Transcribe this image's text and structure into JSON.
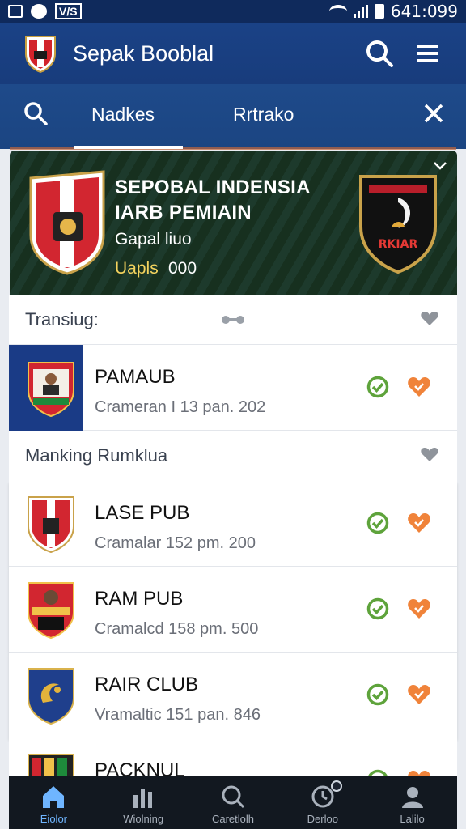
{
  "status_bar": {
    "time": "641:099",
    "left_badge": "V/S"
  },
  "app_bar": {
    "title": "Sepak Booblal"
  },
  "sub_bar": {
    "tabs": [
      {
        "label": "Nadkes"
      },
      {
        "label": "Rrtrako"
      }
    ]
  },
  "hero": {
    "title_line1": "SEPOBAL INDENSIA",
    "title_line2": "IARB PEMIAIN",
    "subtitle": "Gapal liuo",
    "stat_label": "Uapls",
    "stat_value": "000",
    "badge_text": "RKIAR"
  },
  "sections": [
    {
      "title": "Transiug:",
      "rows": [
        {
          "name": "PAMAUB",
          "meta": "Crameran I 13 pan. 202",
          "highlight": true
        }
      ]
    },
    {
      "title": "Manking Rumklua",
      "rows": [
        {
          "name": "LASE PUB",
          "meta": "Cramalar 152 pm. 200"
        },
        {
          "name": "RAM PUB",
          "meta": "Cramalcd 158 pm. 500"
        },
        {
          "name": "RAIR CLUB",
          "meta": "Vramaltic 151 pan. 846"
        },
        {
          "name": "PACKNUL",
          "meta": ""
        }
      ]
    }
  ],
  "bottom_nav": [
    {
      "label": "Eiolor",
      "icon": "home-icon",
      "active": true
    },
    {
      "label": "Wiolning",
      "icon": "stats-icon"
    },
    {
      "label": "Caretlolh",
      "icon": "search-icon"
    },
    {
      "label": "Derloo",
      "icon": "clock-icon"
    },
    {
      "label": "Lalilo",
      "icon": "profile-icon"
    }
  ],
  "colors": {
    "primary": "#1a4286",
    "accent_check": "#5ea33b",
    "accent_fav": "#f0833a",
    "nav_active": "#6fb5ff"
  }
}
